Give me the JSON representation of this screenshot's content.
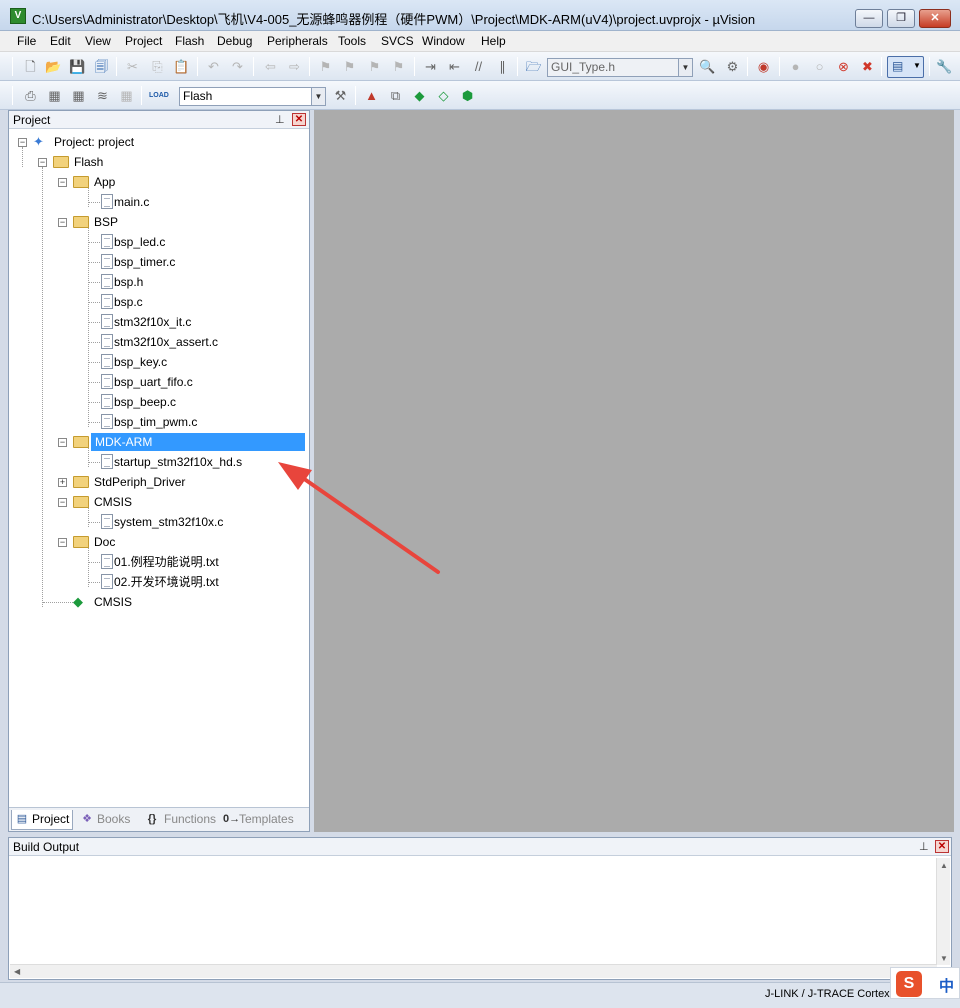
{
  "window": {
    "title": "C:\\Users\\Administrator\\Desktop\\飞机\\V4-005_无源蜂鸣器例程（硬件PWM）\\Project\\MDK-ARM(uV4)\\project.uvprojx - µVision",
    "minimize": "—",
    "maximize": "❐",
    "close": "✕"
  },
  "menu": [
    "File",
    "Edit",
    "View",
    "Project",
    "Flash",
    "Debug",
    "Peripherals",
    "Tools",
    "SVCS",
    "Window",
    "Help"
  ],
  "toolbar": {
    "file_combo": "GUI_Type.h",
    "target_combo": "Flash",
    "load_label": "LOAD"
  },
  "project_pane": {
    "title": "Project",
    "pin": "📌",
    "close": "✕",
    "tree": [
      {
        "label": "Project: project",
        "icon": "project-icon"
      },
      {
        "label": "Flash",
        "icon": "target-icon"
      },
      {
        "label": "App",
        "icon": "folder-icon"
      },
      {
        "label": "main.c",
        "icon": "file-icon"
      },
      {
        "label": "BSP",
        "icon": "folder-icon"
      },
      {
        "label": "bsp_led.c",
        "icon": "file-icon"
      },
      {
        "label": "bsp_timer.c",
        "icon": "file-icon"
      },
      {
        "label": "bsp.h",
        "icon": "file-icon"
      },
      {
        "label": "bsp.c",
        "icon": "file-icon"
      },
      {
        "label": "stm32f10x_it.c",
        "icon": "file-icon"
      },
      {
        "label": "stm32f10x_assert.c",
        "icon": "file-icon"
      },
      {
        "label": "bsp_key.c",
        "icon": "file-icon"
      },
      {
        "label": "bsp_uart_fifo.c",
        "icon": "file-icon"
      },
      {
        "label": "bsp_beep.c",
        "icon": "file-icon"
      },
      {
        "label": "bsp_tim_pwm.c",
        "icon": "file-icon"
      },
      {
        "label": "MDK-ARM",
        "icon": "folder-icon"
      },
      {
        "label": "startup_stm32f10x_hd.s",
        "icon": "file-icon"
      },
      {
        "label": "StdPeriph_Driver",
        "icon": "folder-icon"
      },
      {
        "label": "CMSIS",
        "icon": "folder-icon"
      },
      {
        "label": "system_stm32f10x.c",
        "icon": "file-icon"
      },
      {
        "label": "Doc",
        "icon": "folder-icon"
      },
      {
        "label": "01.例程功能说明.txt",
        "icon": "file-icon"
      },
      {
        "label": "02.开发环境说明.txt",
        "icon": "file-icon"
      },
      {
        "label": "CMSIS",
        "icon": "component-icon"
      }
    ],
    "tabs": [
      {
        "label": "Project",
        "icon": "project-tab-icon"
      },
      {
        "label": "Books",
        "icon": "books-icon"
      },
      {
        "label": "Functions",
        "icon": "functions-icon"
      },
      {
        "label": "Templates",
        "icon": "templates-icon"
      }
    ]
  },
  "build_output": {
    "title": "Build Output",
    "pin": "📌",
    "close": "✕"
  },
  "status": {
    "debugger": "J-LINK / J-TRACE Cortex"
  },
  "ime": {
    "logo": "S",
    "mode": "中"
  },
  "colors": {
    "selection": "#3399ff",
    "editor_bg": "#ababab",
    "annotation_arrow": "#e8453c"
  }
}
